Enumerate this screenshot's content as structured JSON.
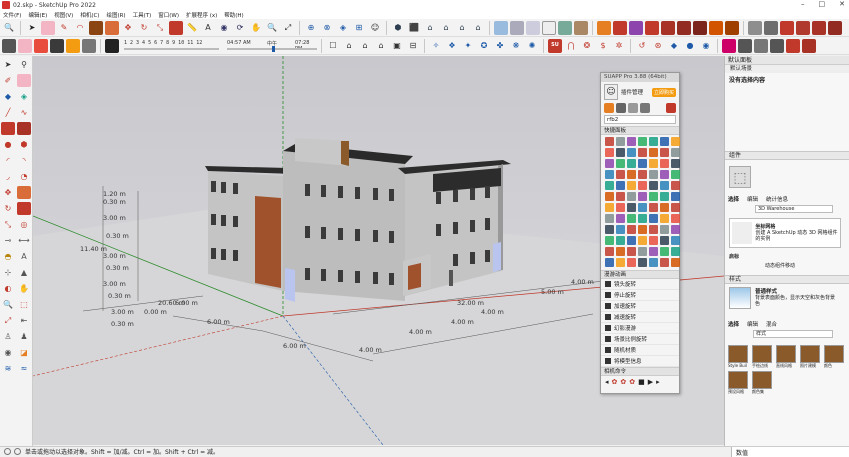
{
  "window": {
    "title": "02.skp - SketchUp Pro 2022",
    "controls": [
      "–",
      "□",
      "✕"
    ]
  },
  "menu": [
    "文件(F)",
    "编辑(E)",
    "视图(V)",
    "相机(C)",
    "绘图(R)",
    "工具(T)",
    "窗口(W)",
    "扩展程序 (x)",
    "帮助(H)"
  ],
  "shadow_bar": {
    "scale": "1 2 3 4 5 6 7 8 9 10 11 12",
    "time_start": "04:57 AM",
    "time_mid": "中午",
    "time_end": "07:28 PM"
  },
  "viewport": {
    "dimensions": [
      "1.20 m",
      "0.30 m",
      "3.00 m",
      "0.30 m",
      "3.00 m",
      "11.40 m",
      "0.30 m",
      "3.00 m",
      "0.30 m",
      "3.00 m",
      "0.30 m",
      "0.00 m",
      "20.60 m",
      "6.00 m",
      "32.00 m",
      "4.00 m",
      "5.00 m",
      "4.00 m",
      "6.00 m",
      "6.00 m",
      "4.00 m",
      "4.00 m",
      "4.00 m"
    ]
  },
  "swapp": {
    "title": "SUAPP Pro 3.88 (64bit)",
    "user_label": "插件管理",
    "badge": "立即购买",
    "search_value": "rfb2",
    "quick_panel": "快捷面板",
    "anim_panel": "漫游动画",
    "anim_items": [
      "镜头旋转",
      "停止旋转",
      "加速旋转",
      "减速旋转",
      "幻影漫游",
      "场景比例旋转",
      "随机材质",
      "将模型信息"
    ],
    "cmd_panel": "相机命令"
  },
  "right_panel": {
    "default_panel": "默认面板",
    "scene_info": "默认场景",
    "no_content": "没有选择内容",
    "components_head": "组件",
    "comp_tabs": [
      "选择",
      "编辑",
      "统计信息"
    ],
    "comp_search": "3D Warehouse",
    "comp_desc": "创建 A SketchUp 动态 3D 网格组件的实例",
    "comp_name": "坐标网格",
    "comp_name2": "启标",
    "comp_more": "动态组件移动",
    "styles_head": "样式",
    "style_name": "普通样式",
    "style_desc": "背景表面颜色，显示天空和灰色背景色",
    "style_tabs": [
      "选择",
      "编辑",
      "混合"
    ],
    "style_dropdown": "样式",
    "style_thumbs": [
      "Style Buil",
      "手绘边线",
      "直线风格",
      "照片建模",
      "颜色",
      "预设风格",
      "颜色集"
    ]
  },
  "status": {
    "hint": "单击或拖动以选择对象。Shift = 加/减。Ctrl = 加。Shift + Ctrl = 减。",
    "measure_label": "数值"
  },
  "colors": {
    "accent_red": "#d3322d",
    "sky": "#c8c8cd",
    "building_wall": "#c8c8c8",
    "brick": "#a0522d",
    "glass_blue": "#b9c4ef"
  }
}
